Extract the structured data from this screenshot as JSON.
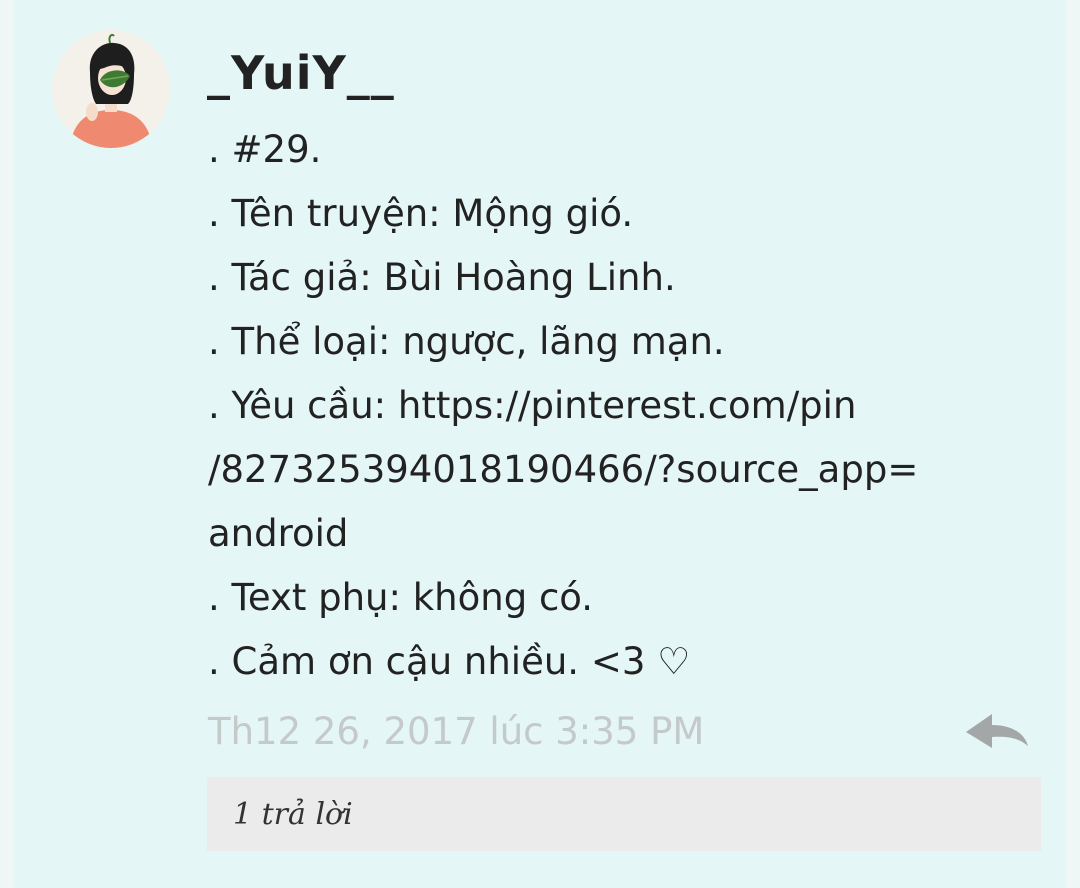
{
  "comment": {
    "username": "_YuiY__",
    "avatar_icon": "avatar-girl-with-leaf-icon",
    "lines": [
      ". #29.",
      ". Tên truyện: Mộng gió.",
      ". Tác giả: Bùi Hoàng Linh.",
      ". Thể loại: ngược, lãng mạn.",
      ". Yêu cầu: https://pinterest.com/pin",
      "/827325394018190466/?source_app=",
      "android",
      ". Text phụ: không có.",
      ". Cảm ơn cậu nhiều. <3 ♡"
    ],
    "timestamp": "Th12 26, 2017 lúc 3:35 PM",
    "reply_icon": "reply-arrow-icon",
    "replies_label": "1 trả lời"
  },
  "colors": {
    "background": "#e4f6f6",
    "text": "#222222",
    "timestamp": "#c4c9c9",
    "reply_icon": "#a3a7a7",
    "replies_box": "#ebebeb"
  }
}
